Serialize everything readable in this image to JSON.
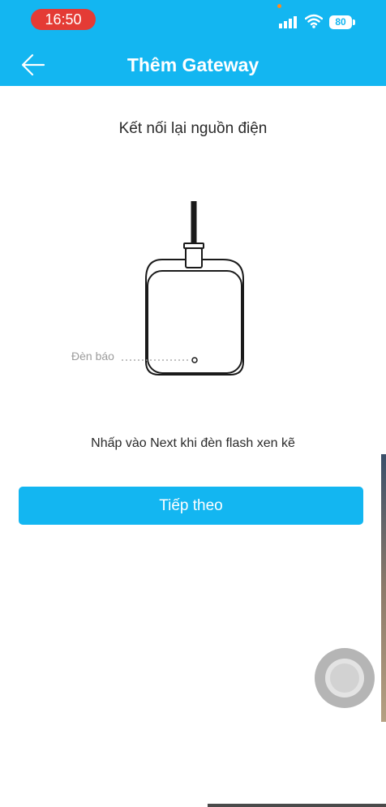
{
  "status_bar": {
    "time": "16:50",
    "battery": "80",
    "signal_icon": "cellular-signal-icon",
    "wifi_icon": "wifi-icon"
  },
  "header": {
    "title": "Thêm Gateway",
    "back_icon": "arrow-left-icon"
  },
  "main": {
    "heading": "Kết nối lại nguồn điện",
    "indicator_label": "Đèn báo",
    "instruction": "Nhấp vào Next khi đèn flash xen kẽ",
    "next_button": "Tiếp theo"
  },
  "colors": {
    "primary": "#13b6f1",
    "status_time_bg": "#e43b35"
  }
}
